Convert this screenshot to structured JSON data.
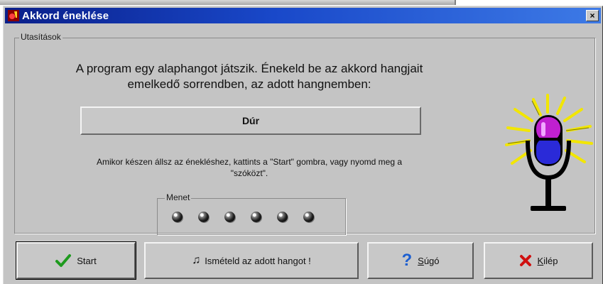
{
  "window": {
    "title": "Akkord éneklése",
    "close_symbol": "×"
  },
  "instructions": {
    "legend": "Utasítások",
    "line1": "A program egy alaphangot játszik. Énekeld be az akkord hangjait",
    "line2": "emelkedő sorrendben, az adott hangnemben:",
    "chord": "Dúr",
    "hint_line1": "Amikor készen állsz az énekléshez, kattints a \"Start\" gombra, vagy nyomd meg a",
    "hint_line2": "\"szóközt\"."
  },
  "progress": {
    "label": "Menet",
    "rounds_total": 6
  },
  "icons": {
    "title": "app-icon",
    "start": "checkmark-icon",
    "repeat": "note-repeat-icon",
    "help": "question-mark-icon",
    "exit": "red-x-icon",
    "illustration": "microphone-icon"
  },
  "buttons": {
    "start": "Start",
    "repeat_prefix": "♫",
    "repeat": "Ismételd az adott hangot !",
    "help_underlined": "S",
    "help_rest": "úgó",
    "exit_underlined": "K",
    "exit_rest": "ilép"
  },
  "colors": {
    "titlebar_start": "#0a1f8a",
    "titlebar_end": "#3d7ae6",
    "face": "#c4c4c4",
    "check_green": "#1e9a1e",
    "exit_red": "#d01010",
    "help_blue": "#1d5fd0"
  }
}
